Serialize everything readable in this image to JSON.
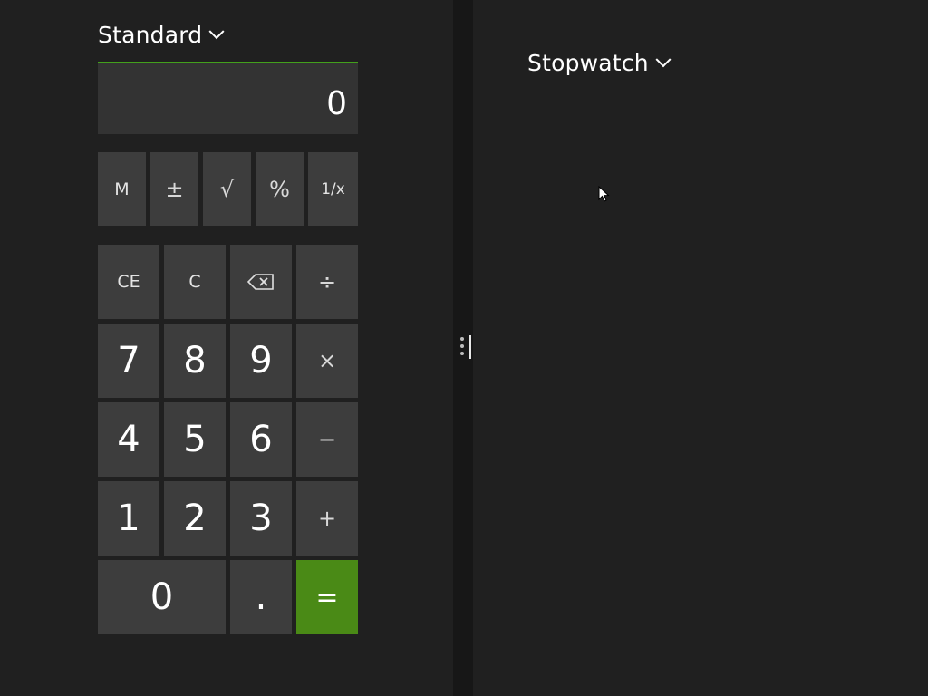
{
  "calculator": {
    "mode": "Standard",
    "display_value": "0",
    "function_row": [
      "M",
      "±",
      "√",
      "%",
      "1/x"
    ],
    "keys": {
      "ce": "CE",
      "c": "C",
      "backspace_icon": "backspace-icon",
      "divide": "÷",
      "seven": "7",
      "eight": "8",
      "nine": "9",
      "multiply": "×",
      "four": "4",
      "five": "5",
      "six": "6",
      "subtract": "−",
      "one": "1",
      "two": "2",
      "three": "3",
      "add": "+",
      "zero": "0",
      "decimal": ".",
      "equals": "="
    }
  },
  "right_app": {
    "mode": "Stopwatch"
  },
  "colors": {
    "accent": "#43a01c",
    "equals_button": "#4a8a16",
    "button": "#3d3d3d",
    "display": "#333333",
    "background": "#202020"
  }
}
